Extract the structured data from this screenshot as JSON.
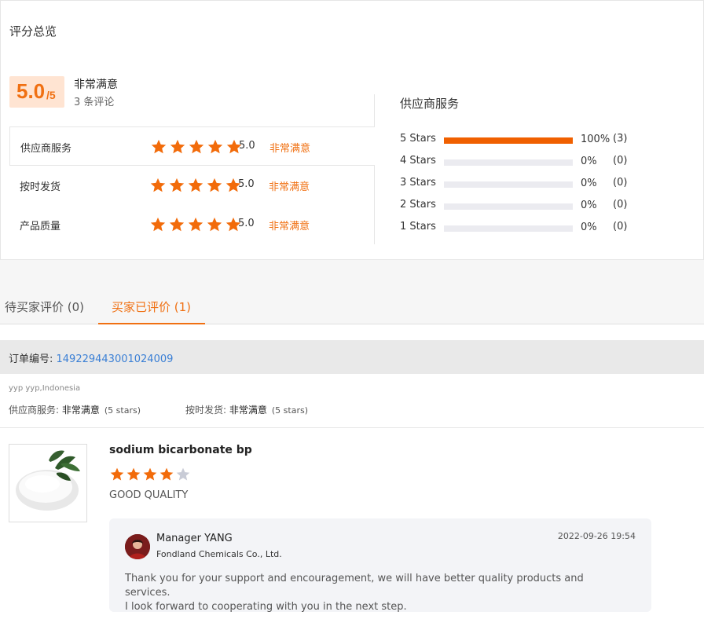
{
  "overview": {
    "title": "评分总览",
    "score": "5.0",
    "score_max": "/5",
    "score_label": "非常满意",
    "review_count": "3 条评论"
  },
  "ratings": [
    {
      "label": "供应商服务",
      "value": "5.0",
      "text": "非常满意",
      "stars": 5
    },
    {
      "label": "按时发货",
      "value": "5.0",
      "text": "非常满意",
      "stars": 5
    },
    {
      "label": "产品质量",
      "value": "5.0",
      "text": "非常满意",
      "stars": 5
    }
  ],
  "distribution": {
    "title": "供应商服务",
    "rows": [
      {
        "label": "5  Stars",
        "fraction": 1.0,
        "percent": "100%",
        "count": "(3)"
      },
      {
        "label": "4  Stars",
        "fraction": 0,
        "percent": "0%",
        "count": "(0)"
      },
      {
        "label": "3  Stars",
        "fraction": 0,
        "percent": "0%",
        "count": "(0)"
      },
      {
        "label": "2  Stars",
        "fraction": 0,
        "percent": "0%",
        "count": "(0)"
      },
      {
        "label": "1  Stars",
        "fraction": 0,
        "percent": "0%",
        "count": "(0)"
      }
    ]
  },
  "tabs": {
    "pending": "待买家评价 (0)",
    "done": "买家已评价 (1)"
  },
  "order": {
    "label": "订单编号: ",
    "number": "149229443001024009"
  },
  "review": {
    "buyer": "yyp yyp,Indonesia",
    "service_key": "供应商服务: ",
    "service_val": "非常满意",
    "service_stars": "(5 stars)",
    "delivery_key": "按时发货: ",
    "delivery_val": "非常满意",
    "delivery_stars": "(5 stars)",
    "product_name": "sodium bicarbonate bp",
    "stars": 4,
    "text": "GOOD QUALITY"
  },
  "reply": {
    "name": "Manager YANG",
    "company": "Fondland Chemicals Co., Ltd.",
    "time": "2022-09-26 19:54",
    "line1": "Thank you for your support and encouragement, we will have better quality products and services.",
    "line2": "I look forward to cooperating with you in the next step."
  },
  "colors": {
    "accent": "#f07012",
    "star_on": "#f26b0a",
    "star_off": "#c8cbd6",
    "link": "#3a7fd5"
  }
}
